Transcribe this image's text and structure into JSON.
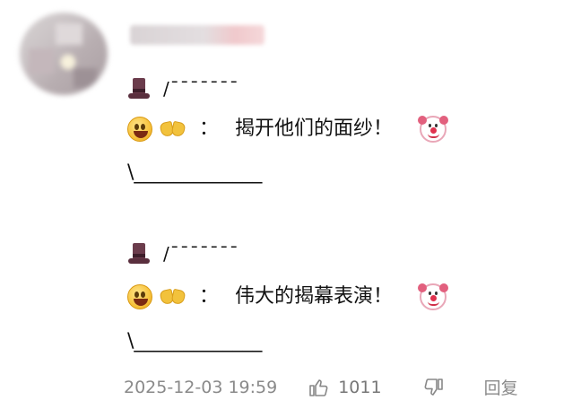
{
  "comment": {
    "blocks": [
      {
        "top_line": "/¯¯¯¯¯¯¯",
        "colon": "：",
        "message": "揭开他们的面纱！",
        "bottom_line": "\\_____________"
      },
      {
        "top_line": "/¯¯¯¯¯¯¯",
        "colon": "：",
        "message": "伟大的揭幕表演！",
        "bottom_line": "\\_____________"
      }
    ],
    "icons": [
      "top-hat-icon",
      "grinning-face-icon",
      "handshake-icon",
      "clown-face-icon"
    ]
  },
  "footer": {
    "timestamp": "2025-12-03 19:59",
    "like_count": "1011",
    "reply_label": "回复"
  }
}
